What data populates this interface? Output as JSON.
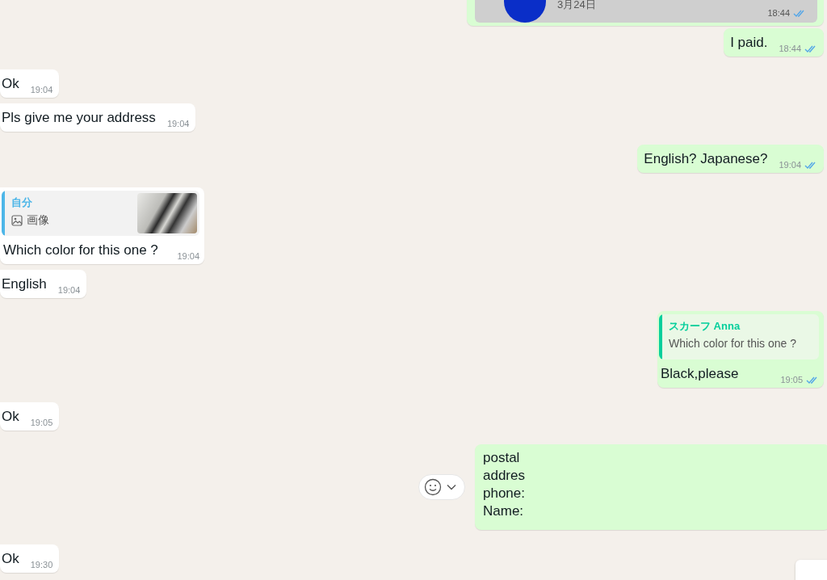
{
  "messages": [
    {
      "outgoing": true,
      "kind": "card",
      "card": {
        "date": "3月24日"
      },
      "time": "18:44",
      "read": true
    },
    {
      "outgoing": true,
      "kind": "text",
      "text": "I paid.",
      "time": "18:44",
      "read": true
    },
    {
      "outgoing": false,
      "kind": "text",
      "text": "Ok",
      "time": "19:04"
    },
    {
      "outgoing": false,
      "kind": "text",
      "text": "Pls give me your address",
      "time": "19:04"
    },
    {
      "outgoing": true,
      "kind": "text",
      "text": "English? Japanese?",
      "time": "19:04",
      "read": true
    },
    {
      "outgoing": false,
      "kind": "reply",
      "quote": {
        "author": "自分",
        "text": "画像",
        "media": true,
        "color": "#4db6e8"
      },
      "text": "Which color for this one ?",
      "time": "19:04"
    },
    {
      "outgoing": false,
      "kind": "text",
      "text": "English",
      "time": "19:04"
    },
    {
      "outgoing": true,
      "kind": "reply",
      "quote": {
        "author": "スカーフ Anna",
        "text": "Which color for this one ?",
        "media": false,
        "color": "#06cf9c"
      },
      "text": "Black,please",
      "time": "19:05",
      "read": true
    },
    {
      "outgoing": false,
      "kind": "text",
      "text": "Ok",
      "time": "19:05"
    },
    {
      "outgoing": true,
      "kind": "lines",
      "lines": [
        "postal",
        "addres",
        "phone:",
        "Name:"
      ],
      "reaction_button": true
    },
    {
      "outgoing": false,
      "kind": "text",
      "text": "Ok",
      "time": "19:30"
    }
  ]
}
